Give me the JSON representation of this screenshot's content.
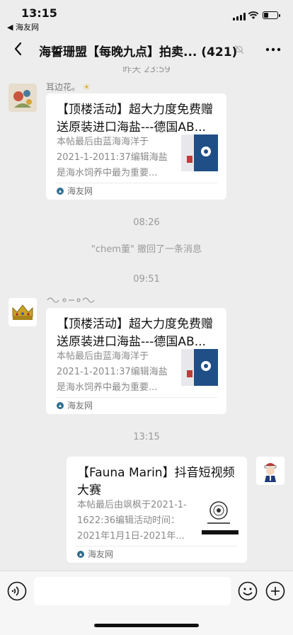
{
  "status_bar": {
    "time": "13:15",
    "back_app": "◀ 海友网"
  },
  "nav": {
    "title": "海誓珊盟【每晚九点】拍卖...",
    "count": "(421)"
  },
  "chat": {
    "top_partial_time": "昨天 23:59",
    "messages": [
      {
        "nickname": "耳边花。",
        "card": {
          "title": "【顶楼活动】超大力度免费赠送原装进口海盐---德国AB...",
          "desc": "本帖最后由蓝海海洋于2021-1-2011:37编辑海盐是海水饲养中最为重要...",
          "source": "海友网"
        }
      },
      {
        "nickname": "",
        "card": {
          "title": "【顶楼活动】超大力度免费赠送原装进口海盐---德国AB...",
          "desc": "本帖最后由蓝海海洋于2021-1-2011:37编辑海盐是海水饲养中最为重要...",
          "source": "海友网"
        }
      },
      {
        "nickname": "",
        "card": {
          "title": "【Fauna Marin】抖音短视频大赛",
          "desc": "本帖最后由飒枫于2021-1-1622:36编辑活动时间：2021年1月1日-2021年...",
          "source": "海友网"
        }
      }
    ],
    "time_1": "08:26",
    "recall_notice": "\"chem董\" 撤回了一条消息",
    "time_2": "09:51",
    "time_3": "13:15"
  },
  "icons": {
    "back": "chevron-left-icon",
    "mute": "mute-bell-icon",
    "more": "more-dots-icon",
    "voice": "voice-icon",
    "emoji": "emoji-icon",
    "plus": "plus-icon",
    "source": "haiyou-logo-icon"
  },
  "colors": {
    "background": "#ededed",
    "card": "#ffffff",
    "muted_text": "#9a9a9a"
  }
}
